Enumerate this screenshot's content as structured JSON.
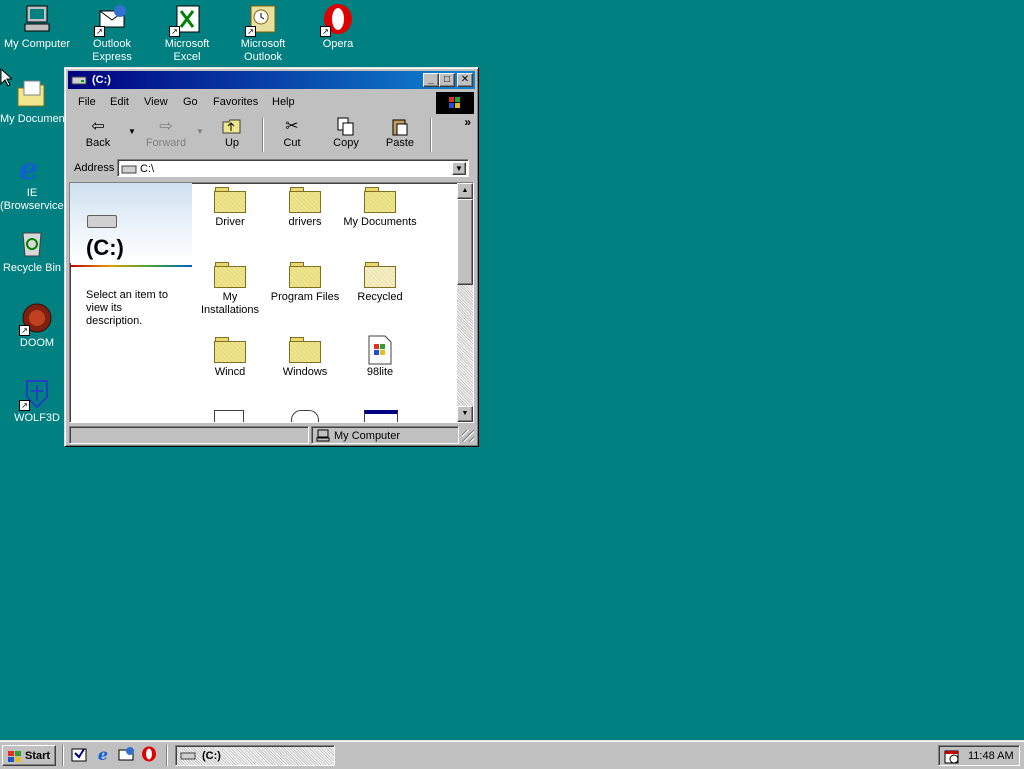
{
  "desktop": {
    "icons": [
      {
        "label": "My Computer"
      },
      {
        "label": "Outlook Express"
      },
      {
        "label": "Microsoft Excel"
      },
      {
        "label": "Microsoft Outlook"
      },
      {
        "label": "Opera"
      },
      {
        "label": "My Documents"
      },
      {
        "label": "IE (Browservice)"
      },
      {
        "label": "Recycle Bin"
      },
      {
        "label": "DOOM"
      },
      {
        "label": "WOLF3D"
      }
    ]
  },
  "window": {
    "title": "(C:)",
    "menu": [
      "File",
      "Edit",
      "View",
      "Go",
      "Favorites",
      "Help"
    ],
    "toolbar": {
      "back": "Back",
      "forward": "Forward",
      "up": "Up",
      "cut": "Cut",
      "copy": "Copy",
      "paste": "Paste",
      "more": "»"
    },
    "address": {
      "label": "Address",
      "value": "C:\\"
    },
    "left_pane": {
      "drive_title": "(C:)",
      "description": "Select an item to view its description."
    },
    "files": [
      {
        "name": "Driver",
        "type": "folder"
      },
      {
        "name": "drivers",
        "type": "folder"
      },
      {
        "name": "My Documents",
        "type": "folder"
      },
      {
        "name": "My Installations",
        "type": "folder"
      },
      {
        "name": "Program Files",
        "type": "folder"
      },
      {
        "name": "Recycled",
        "type": "folder-pale"
      },
      {
        "name": "Wincd",
        "type": "folder"
      },
      {
        "name": "Windows",
        "type": "folder"
      },
      {
        "name": "98lite",
        "type": "setup-file"
      }
    ],
    "status": {
      "location": "My Computer"
    }
  },
  "taskbar": {
    "start_label": "Start",
    "task_label": "(C:)",
    "clock": "11:48 AM"
  }
}
